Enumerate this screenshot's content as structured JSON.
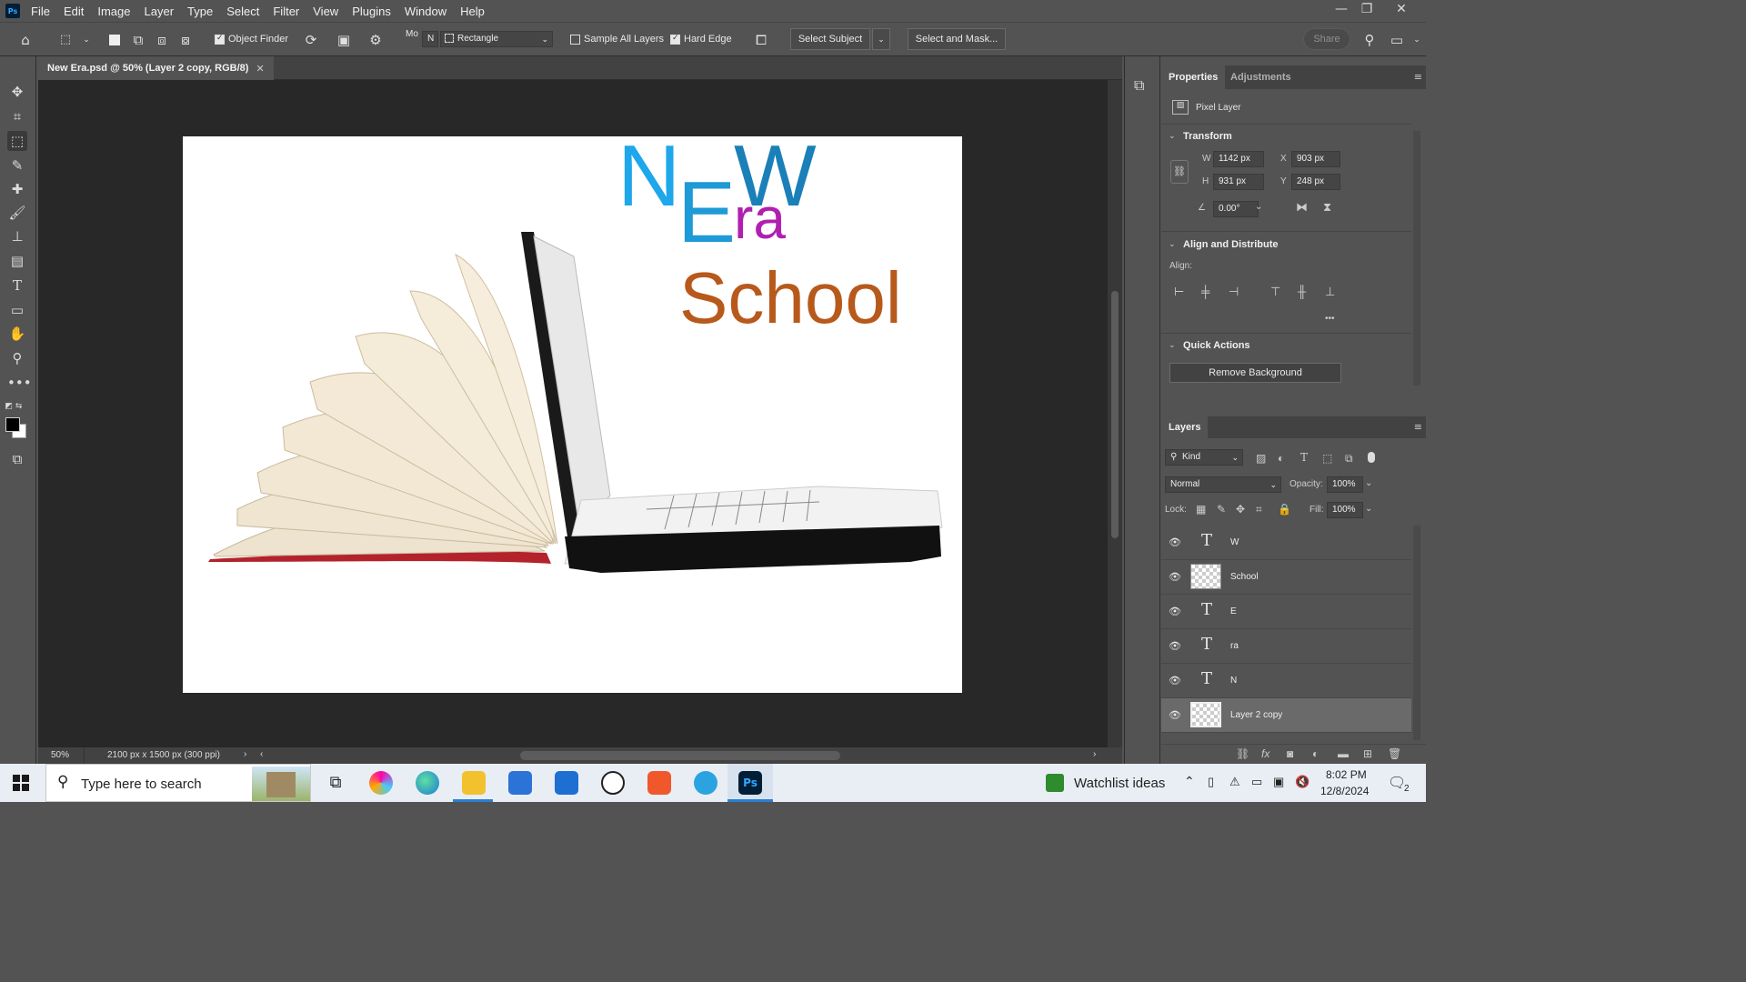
{
  "app": {
    "logo": "Ps"
  },
  "menu": [
    "File",
    "Edit",
    "Image",
    "Layer",
    "Type",
    "Select",
    "Filter",
    "View",
    "Plugins",
    "Window",
    "Help"
  ],
  "window_controls": {
    "minimize": "—",
    "restore": "❐",
    "close": "✕"
  },
  "options_bar": {
    "object_finder": "Object Finder",
    "mode_label": "Mo",
    "mode_value": "N",
    "selection_shape": "Rectangle",
    "sample_all_layers": "Sample All Layers",
    "hard_edge": "Hard Edge",
    "select_subject": "Select Subject",
    "select_and_mask": "Select and Mask...",
    "share": "Share"
  },
  "document": {
    "tab_title": "New Era.psd @ 50% (Layer 2 copy, RGB/8)",
    "zoom": "50%",
    "dimensions": "2100 px x 1500 px (300 ppi)"
  },
  "artwork": {
    "letter_n": "N",
    "letter_e": "E",
    "letter_w": "W",
    "text_ra": "ra",
    "text_school": "School",
    "colors": {
      "n": "#1ea7ea",
      "e": "#1e9ad6",
      "w": "#1b7fb8",
      "ra": "#b020b0",
      "school": "#b8591c"
    }
  },
  "properties": {
    "tabs": [
      "Properties",
      "Adjustments"
    ],
    "layer_type": "Pixel Layer",
    "transform_header": "Transform",
    "w_label": "W",
    "w_value": "1142 px",
    "h_label": "H",
    "h_value": "931 px",
    "x_label": "X",
    "x_value": "903 px",
    "y_label": "Y",
    "y_value": "248 px",
    "angle_value": "0.00°",
    "align_header": "Align and Distribute",
    "align_label": "Align:",
    "more": "•••",
    "quick_actions_header": "Quick Actions",
    "remove_background": "Remove Background"
  },
  "layers": {
    "tab": "Layers",
    "filter_kind": "Kind",
    "blend_mode": "Normal",
    "opacity_label": "Opacity:",
    "opacity_value": "100%",
    "lock_label": "Lock:",
    "fill_label": "Fill:",
    "fill_value": "100%",
    "items": [
      {
        "name": "W",
        "kind": "type"
      },
      {
        "name": "School",
        "kind": "pixel"
      },
      {
        "name": "E",
        "kind": "type"
      },
      {
        "name": "ra",
        "kind": "type"
      },
      {
        "name": "N",
        "kind": "type"
      },
      {
        "name": "Layer 2 copy",
        "kind": "pixel"
      }
    ]
  },
  "taskbar": {
    "search_placeholder": "Type here to search",
    "watchlist": "Watchlist ideas",
    "time": "8:02 PM",
    "date": "12/8/2024",
    "notifications": "2"
  }
}
